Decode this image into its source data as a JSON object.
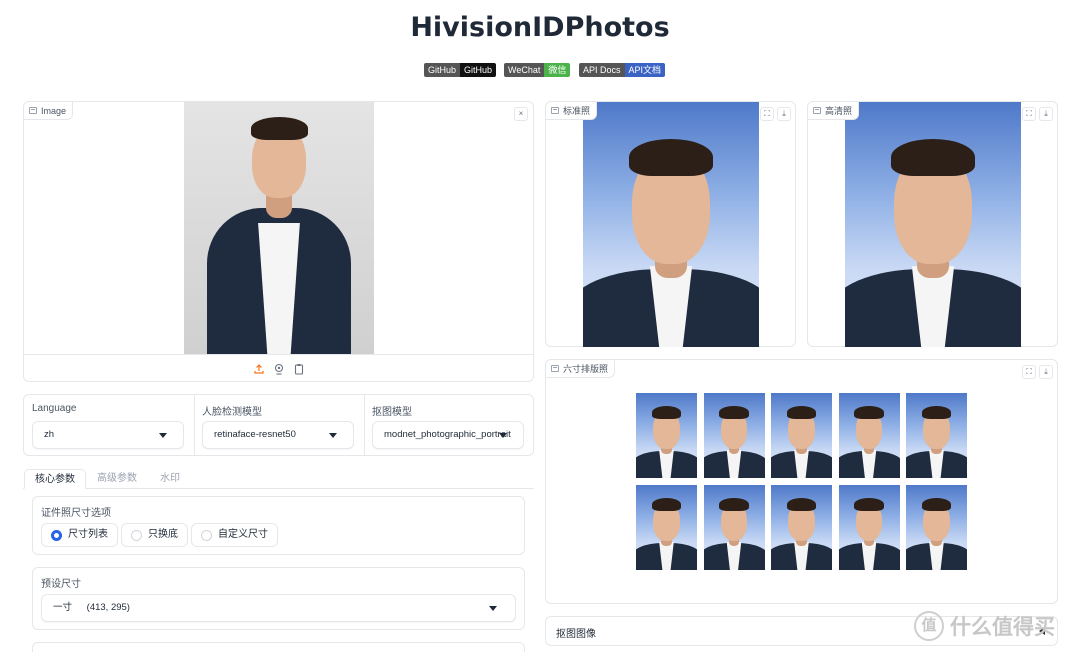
{
  "app_title": "HivisionIDPhotos",
  "badges": [
    {
      "left": "GitHub",
      "right": "GitHub",
      "color": "#111111"
    },
    {
      "left": "WeChat",
      "right": "微信",
      "color": "#4cb34b"
    },
    {
      "left": "API Docs",
      "right": "API文档",
      "color": "#3b63c4"
    }
  ],
  "input_panel": {
    "label": "Image",
    "close_icon": "×"
  },
  "outputs": {
    "standard": {
      "label": "标准照"
    },
    "hd": {
      "label": "高清照"
    },
    "layout": {
      "label": "六寸排版照"
    },
    "matting": {
      "label": "抠图图像"
    }
  },
  "controls": {
    "language": {
      "label": "Language",
      "value": "zh"
    },
    "face_model": {
      "label": "人脸检测模型",
      "value": "retinaface-resnet50"
    },
    "matting_model": {
      "label": "抠图模型",
      "value": "modnet_photographic_portrait"
    }
  },
  "tabs": [
    "核心参数",
    "高级参数",
    "水印"
  ],
  "size_options": {
    "label": "证件照尺寸选项",
    "options": [
      "尺寸列表",
      "只换底",
      "自定义尺寸"
    ],
    "selected": 0
  },
  "preset_size": {
    "label": "预设尺寸",
    "value": "一寸",
    "dims": "(413, 295)"
  },
  "watermark": {
    "text": "什么值得买",
    "logo": "值"
  },
  "colors": {
    "accent": "#2563eb",
    "upload_icon": "#f97316",
    "border": "#e5e7eb"
  }
}
